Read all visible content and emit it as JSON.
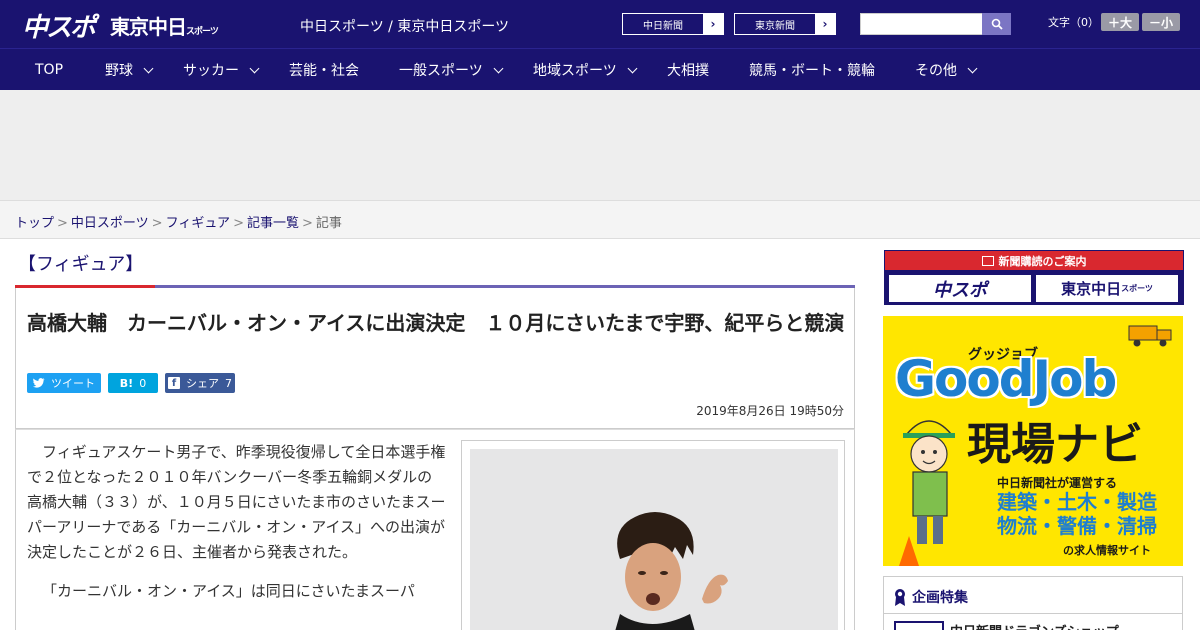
{
  "header": {
    "logo_main": "中スポ",
    "logo_tokyo": "東京中日",
    "logo_tokyo_small": "スポーツ",
    "site_names": "中日スポーツ / 東京中日スポーツ",
    "paper_links": [
      "中日新聞",
      "東京新聞"
    ],
    "search": {
      "value": "",
      "placeholder": ""
    },
    "font_size_label": "文字（0）",
    "font_larger": "＋大",
    "font_smaller": "－小"
  },
  "nav": {
    "items": [
      {
        "label": "TOP",
        "has_menu": false
      },
      {
        "label": "野球",
        "has_menu": true
      },
      {
        "label": "サッカー",
        "has_menu": true
      },
      {
        "label": "芸能・社会",
        "has_menu": false
      },
      {
        "label": "一般スポーツ",
        "has_menu": true
      },
      {
        "label": "地域スポーツ",
        "has_menu": true
      },
      {
        "label": "大相撲",
        "has_menu": false
      },
      {
        "label": "競馬・ボート・競輪",
        "has_menu": false
      },
      {
        "label": "その他",
        "has_menu": true
      }
    ]
  },
  "breadcrumb": {
    "links": [
      "トップ",
      "中日スポーツ",
      "フィギュア",
      "記事一覧"
    ],
    "current": "記事",
    "separator": ">"
  },
  "article": {
    "category": "【フィギュア】",
    "title": "高橋大輔　カーニバル・オン・アイスに出演決定　１０月にさいたまで宇野、紀平らと競演",
    "share": {
      "tweet": "ツイート",
      "hatena_icon": "B!",
      "hatena_count": "0",
      "facebook": "シェア",
      "facebook_count": "7"
    },
    "date": "2019年8月26日 19時50分",
    "paragraphs": [
      "フィギュアスケート男子で、昨季現役復帰して全日本選手権で２位となった２０１０年バンクーバー冬季五輪銅メダルの高橋大輔（３３）が、１０月５日にさいたま市のさいたまスーパーアリーナである「カーニバル・オン・アイス」への出演が決定したことが２６日、主催者から発表された。",
      "「カーニバル・オン・アイス」は同日にさいたまスーパ"
    ]
  },
  "sidebar": {
    "subscribe_head": "新聞購読のご案内",
    "subscribe_logos": [
      "中スポ",
      "東京中日"
    ],
    "subscribe_logo_small": "スポーツ",
    "ad": {
      "kana": "グッジョブ",
      "title": "GoodJob",
      "navi": "現場ナビ",
      "line1": "中日新聞社が運営する",
      "line2": "建築・土木・製造",
      "line3": "物流・警備・清掃",
      "line4": "の求人情報サイト"
    },
    "feature_title": "企画特集",
    "feature_item": "中日新聞ドラゴンズショップ"
  },
  "colors": {
    "brand_navy": "#1a1370",
    "accent_red": "#d9282f",
    "accent_purple": "#6c63b5",
    "twitter": "#1da1f2",
    "hatena": "#00a4de",
    "facebook": "#3b5998",
    "ad_yellow": "#ffe600",
    "ad_blue": "#1f7fcf"
  }
}
